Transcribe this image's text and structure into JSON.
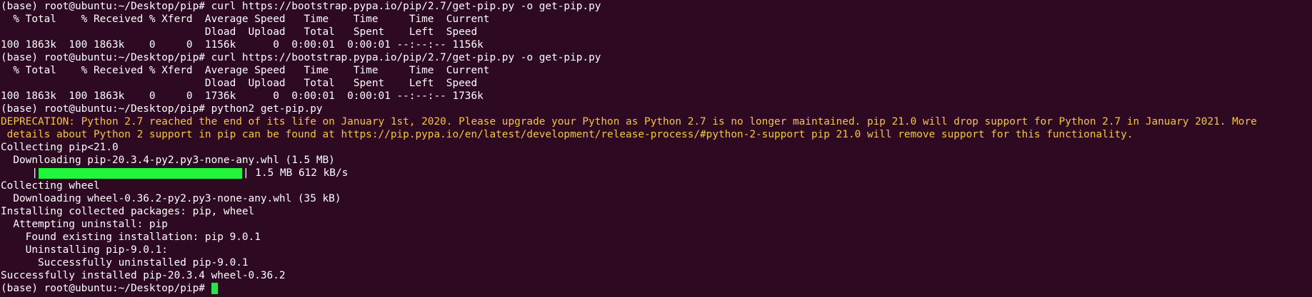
{
  "terminal": {
    "lines": [
      {
        "kind": "command",
        "prompt": "(base) root@ubuntu:~/Desktop/pip#",
        "text": " curl https://bootstrap.pypa.io/pip/2.7/get-pip.py -o get-pip.py"
      },
      {
        "kind": "output",
        "text": "  % Total    % Received % Xferd  Average Speed   Time    Time     Time  Current"
      },
      {
        "kind": "output",
        "text": "                                 Dload  Upload   Total   Spent    Left  Speed"
      },
      {
        "kind": "output",
        "text": "100 1863k  100 1863k    0     0  1156k      0  0:00:01  0:00:01 --:--:-- 1156k"
      },
      {
        "kind": "command",
        "prompt": "(base) root@ubuntu:~/Desktop/pip#",
        "text": " curl https://bootstrap.pypa.io/pip/2.7/get-pip.py -o get-pip.py"
      },
      {
        "kind": "output",
        "text": "  % Total    % Received % Xferd  Average Speed   Time    Time     Time  Current"
      },
      {
        "kind": "output",
        "text": "                                 Dload  Upload   Total   Spent    Left  Speed"
      },
      {
        "kind": "output",
        "text": "100 1863k  100 1863k    0     0  1736k      0  0:00:01  0:00:01 --:--:-- 1736k"
      },
      {
        "kind": "command",
        "prompt": "(base) root@ubuntu:~/Desktop/pip#",
        "text": " python2 get-pip.py"
      },
      {
        "kind": "warning",
        "text": "DEPRECATION: Python 2.7 reached the end of its life on January 1st, 2020. Please upgrade your Python as Python 2.7 is no longer maintained. pip 21.0 will drop support for Python 2.7 in January 2021. More"
      },
      {
        "kind": "warning",
        "text": " details about Python 2 support in pip can be found at https://pip.pypa.io/en/latest/development/release-process/#python-2-support pip 21.0 will remove support for this functionality."
      },
      {
        "kind": "output",
        "text": "Collecting pip<21.0"
      },
      {
        "kind": "output",
        "text": "  Downloading pip-20.3.4-py2.py3-none-any.whl (1.5 MB)"
      },
      {
        "kind": "progress",
        "prefix": "     |",
        "suffix": "| 1.5 MB 612 kB/s",
        "progress": 1.0
      },
      {
        "kind": "output",
        "text": "Collecting wheel"
      },
      {
        "kind": "output",
        "text": "  Downloading wheel-0.36.2-py2.py3-none-any.whl (35 kB)"
      },
      {
        "kind": "output",
        "text": "Installing collected packages: pip, wheel"
      },
      {
        "kind": "output",
        "text": "  Attempting uninstall: pip"
      },
      {
        "kind": "output",
        "text": "    Found existing installation: pip 9.0.1"
      },
      {
        "kind": "output",
        "text": "    Uninstalling pip-9.0.1:"
      },
      {
        "kind": "output",
        "text": "      Successfully uninstalled pip-9.0.1"
      },
      {
        "kind": "output",
        "text": "Successfully installed pip-20.3.4 wheel-0.36.2"
      },
      {
        "kind": "input",
        "prompt": "(base) root@ubuntu:~/Desktop/pip#",
        "text": " "
      }
    ]
  },
  "colors": {
    "background": "#2d0922",
    "foreground": "#ffffff",
    "warning": "#f5c542",
    "progress": "#1ff53a",
    "cursor": "#2be24a"
  }
}
